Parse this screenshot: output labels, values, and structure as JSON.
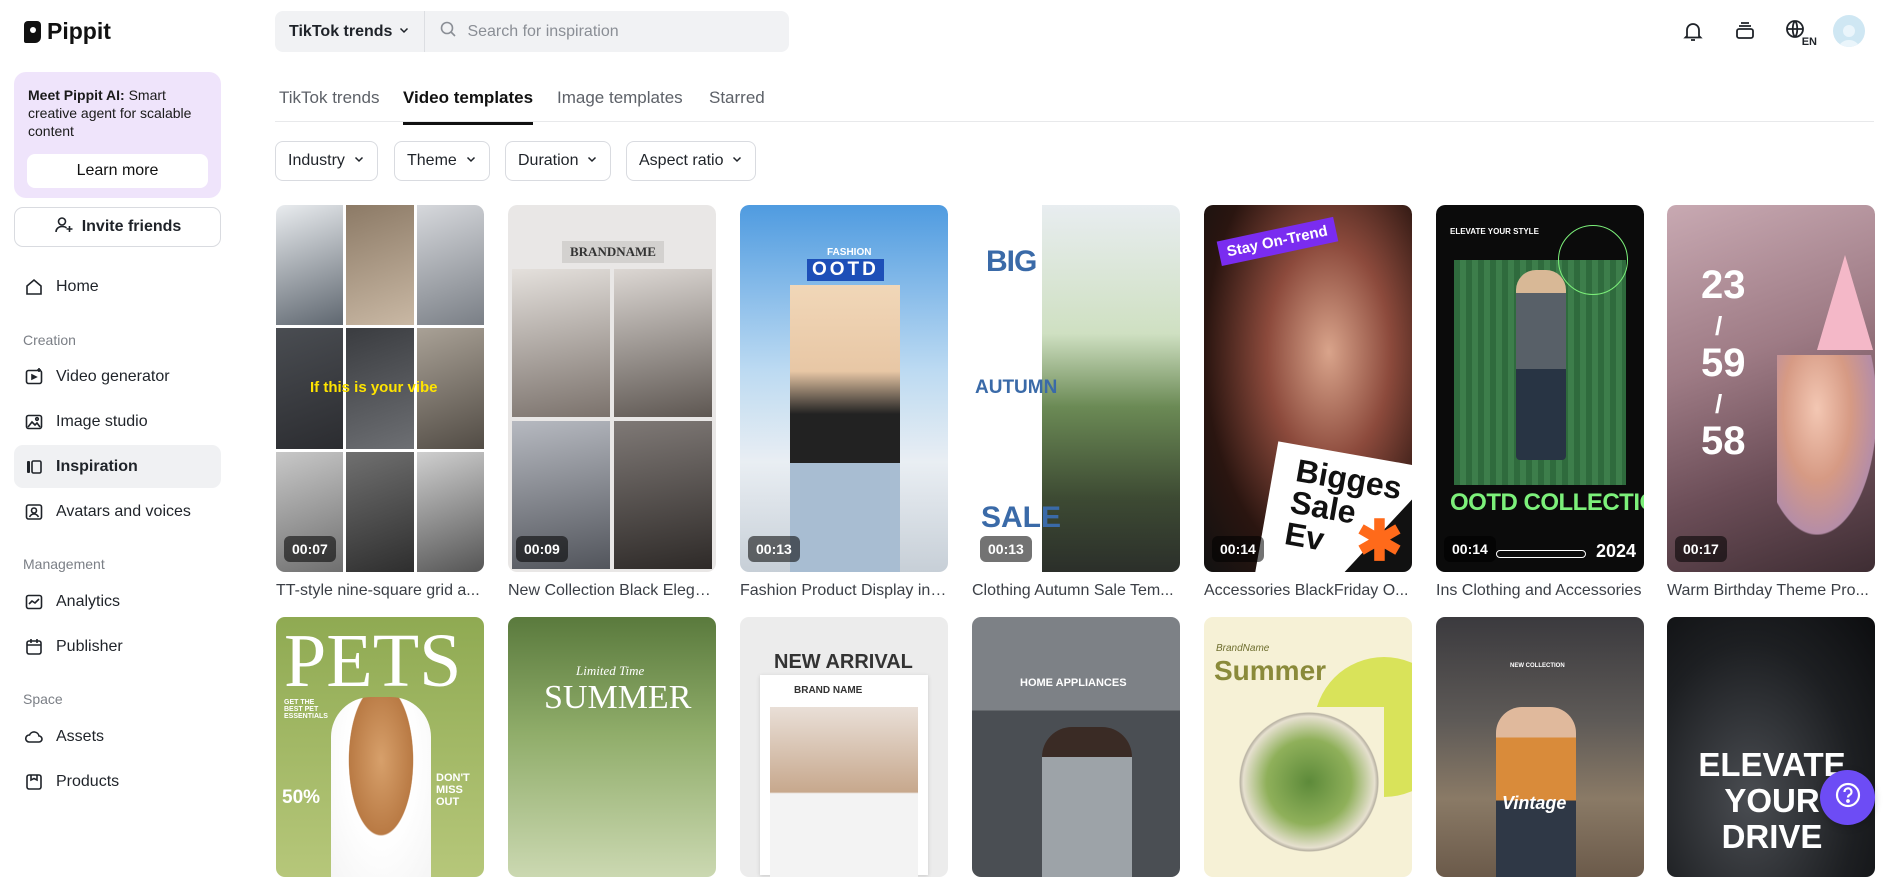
{
  "brand": {
    "name": "Pippit"
  },
  "promo": {
    "title": "Meet Pippit AI:",
    "text": " Smart creative agent for scalable content",
    "button": "Learn more"
  },
  "invite": {
    "label": "Invite friends"
  },
  "nav": {
    "home": "Home",
    "creation_label": "Creation",
    "video_generator": "Video generator",
    "image_studio": "Image studio",
    "inspiration": "Inspiration",
    "avatars": "Avatars and voices",
    "management_label": "Management",
    "analytics": "Analytics",
    "publisher": "Publisher",
    "space_label": "Space",
    "assets": "Assets",
    "products": "Products"
  },
  "search": {
    "selector": "TikTok trends",
    "placeholder": "Search for inspiration"
  },
  "header": {
    "language": "EN"
  },
  "tabs": [
    "TikTok trends",
    "Video templates",
    "Image templates",
    "Starred"
  ],
  "active_tab": "Video templates",
  "filters": [
    "Industry",
    "Theme",
    "Duration",
    "Aspect ratio"
  ],
  "cards": [
    {
      "title": "TT-style nine-square grid a...",
      "duration": "00:07",
      "overlay": "If this is your vibe"
    },
    {
      "title": "New Collection Black Elega...",
      "duration": "00:09",
      "overlay": "BRANDNAME"
    },
    {
      "title": "Fashion Product Display in ...",
      "duration": "00:13",
      "overlay_top": "FASHION",
      "overlay": "OOTD"
    },
    {
      "title": "Clothing Autumn Sale Tem...",
      "duration": "00:13",
      "overlay_top": "BIG",
      "overlay": "AUTUMN",
      "overlay_bottom": "SALE"
    },
    {
      "title": "Accessories BlackFriday O...",
      "duration": "00:14",
      "overlay_top": "Stay On-Trend",
      "overlay": "Bigges Sale Ev"
    },
    {
      "title": "Ins Clothing and Accessories",
      "duration": "00:14",
      "overlay_top": "ELEVATE YOUR STYLE",
      "overlay": "OOTD COLLECTION",
      "overlay_bottom": "2024"
    },
    {
      "title": "Warm Birthday Theme Pro...",
      "duration": "00:17",
      "overlay_top": "23",
      "overlay": "59",
      "overlay_bottom": "58"
    }
  ],
  "row2": [
    {
      "overlay": "PETS",
      "overlay_left": "GET THE BEST PET ESSENTIALS",
      "overlay_right": "DON'T MISS OUT",
      "overlay_num": "50%"
    },
    {
      "overlay_top": "Limited Time",
      "overlay": "SUMMER"
    },
    {
      "overlay": "NEW ARRIVAL",
      "overlay_sub": "BRAND NAME"
    },
    {
      "overlay": "HOME APPLIANCES"
    },
    {
      "overlay_top": "BrandName",
      "overlay": "Summer"
    },
    {
      "overlay_top": "NEW COLLECTION",
      "overlay": "Vintage"
    },
    {
      "overlay": "ELEVATE YOUR DRIVE"
    }
  ],
  "colors": {
    "accent": "#6d4cf5",
    "promo_bg": "#efe4fb",
    "active_nav": "#f0f1f3"
  }
}
